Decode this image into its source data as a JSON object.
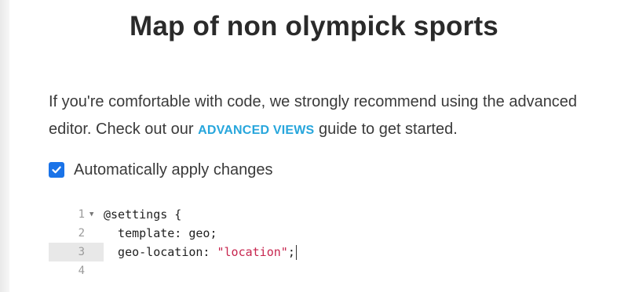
{
  "page": {
    "title": "Map of non olympick sports"
  },
  "intro": {
    "text_before": "If you're comfortable with code, we strongly recommend using the advanced editor. Check out our ",
    "link_label": "ADVANCED VIEWS",
    "text_after": " guide to get started."
  },
  "auto_apply": {
    "label": "Automatically apply changes",
    "checked": true
  },
  "editor": {
    "lines": [
      {
        "num": "1",
        "code": "@settings {",
        "foldable": true
      },
      {
        "num": "2",
        "code": "  template: geo;"
      },
      {
        "num": "3",
        "code_prefix": "  geo-location: ",
        "code_string": "\"location\"",
        "code_suffix": ";",
        "active": true
      },
      {
        "num": "4",
        "code": ""
      }
    ],
    "fold_icon": "triangle-down-icon"
  },
  "colors": {
    "link": "#27a6dc",
    "checkbox": "#1a73e8",
    "string": "#c7254e"
  }
}
